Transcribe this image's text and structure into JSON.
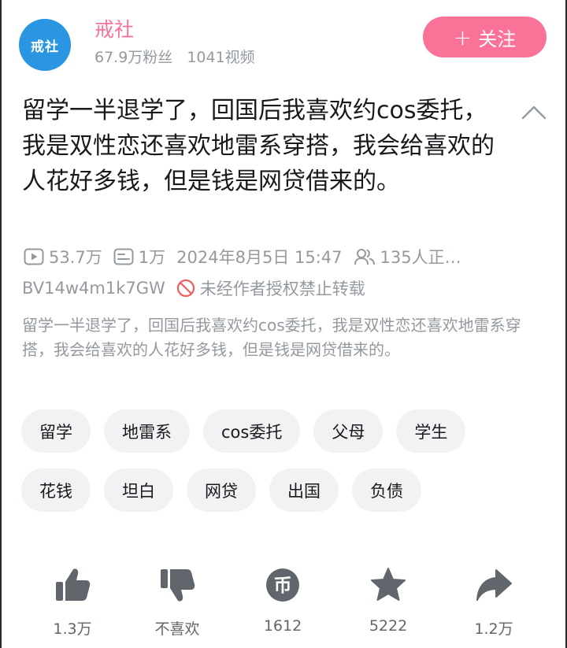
{
  "uploader": {
    "avatar_text": "戒社",
    "name": "戒社",
    "followers": "67.9万粉丝",
    "videos": "1041视频",
    "follow_label": "关注",
    "follow_plus": "+"
  },
  "video": {
    "title": "留学一半退学了，回国后我喜欢约cos委托，我是双性恋还喜欢地雷系穿搭，我会给喜欢的人花好多钱，但是钱是网贷借来的。",
    "views": "53.7万",
    "danmaku": "1万",
    "publish_time": "2024年8月5日 15:47",
    "watching": "135人正…",
    "bvid": "BV14w4m1k7GW",
    "copyright_notice": "未经作者授权禁止转载",
    "description": "留学一半退学了，回国后我喜欢约cos委托，我是双性恋还喜欢地雷系穿搭，我会给喜欢的人花好多钱，但是钱是网贷借来的。"
  },
  "tags": [
    [
      "留学",
      "地雷系",
      "cos委托",
      "父母",
      "学生"
    ],
    [
      "花钱",
      "坦白",
      "网贷",
      "出国",
      "负债"
    ]
  ],
  "actions": {
    "like": "1.3万",
    "dislike": "不喜欢",
    "coin": "1612",
    "favorite": "5222",
    "share": "1.2万"
  },
  "colors": {
    "accent_pink": "#fb7299",
    "avatar_blue": "#2a95e0",
    "icon_gray": "#61666d",
    "meta_gray": "#9499a0"
  }
}
